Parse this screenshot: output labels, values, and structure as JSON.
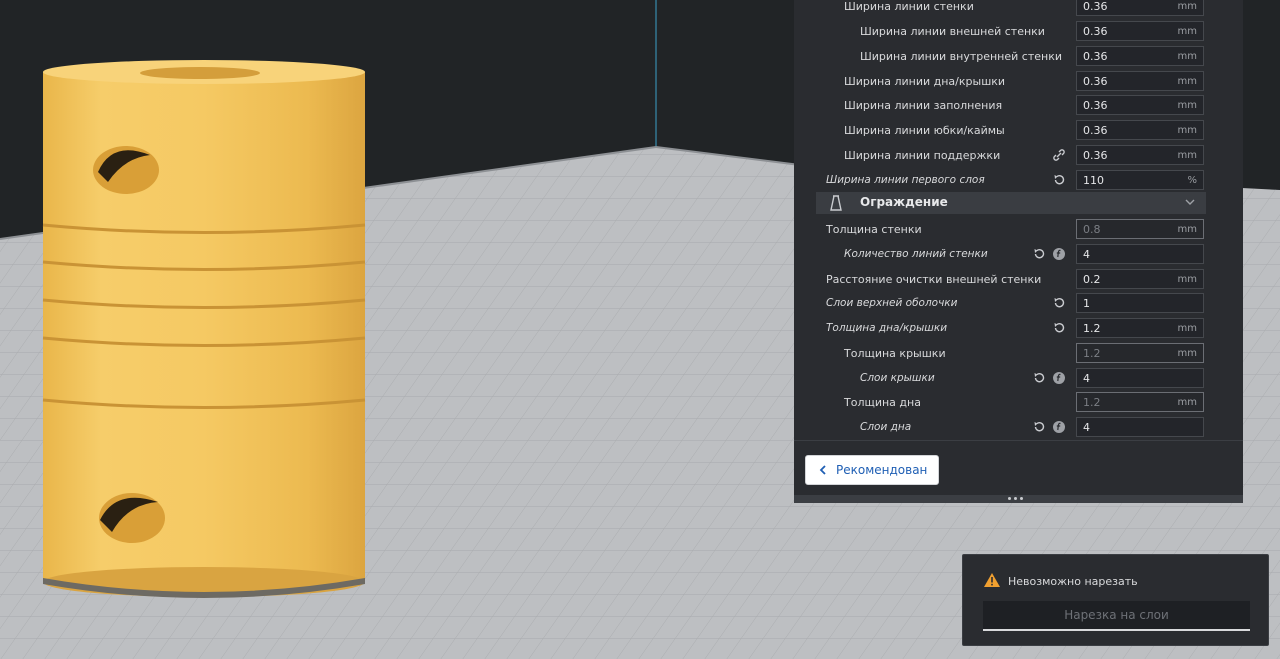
{
  "settings": {
    "line_width_rows": [
      {
        "label": "Ширина линии стенки",
        "value": "0.36",
        "unit": "mm"
      },
      {
        "label": "Ширина линии внешней стенки",
        "value": "0.36",
        "unit": "mm"
      },
      {
        "label": "Ширина линии внутренней стенки",
        "value": "0.36",
        "unit": "mm"
      },
      {
        "label": "Ширина линии дна/крышки",
        "value": "0.36",
        "unit": "mm"
      },
      {
        "label": "Ширина линии заполнения",
        "value": "0.36",
        "unit": "mm"
      },
      {
        "label": "Ширина линии юбки/каймы",
        "value": "0.36",
        "unit": "mm"
      },
      {
        "label": "Ширина линии поддержки",
        "value": "0.36",
        "unit": "mm"
      },
      {
        "label": "Ширина линии первого слоя",
        "value": "110",
        "unit": "%"
      }
    ],
    "section": {
      "title": "Ограждение"
    },
    "shell_rows": [
      {
        "label": "Толщина стенки",
        "value": "0.8",
        "unit": "mm"
      },
      {
        "label": "Количество линий стенки",
        "value": "4",
        "unit": ""
      },
      {
        "label": "Расстояние очистки внешней стенки",
        "value": "0.2",
        "unit": "mm"
      },
      {
        "label": "Слои верхней оболочки",
        "value": "1",
        "unit": ""
      },
      {
        "label": "Толщина дна/крышки",
        "value": "1.2",
        "unit": "mm"
      },
      {
        "label": "Толщина крышки",
        "value": "1.2",
        "unit": "mm"
      },
      {
        "label": "Слои крышки",
        "value": "4",
        "unit": ""
      },
      {
        "label": "Толщина дна",
        "value": "1.2",
        "unit": "mm"
      },
      {
        "label": "Слои дна",
        "value": "4",
        "unit": ""
      }
    ]
  },
  "bottom": {
    "recommended_label": "Рекомендован"
  },
  "toast": {
    "message": "Невозможно нарезать",
    "slice_button_label": "Нарезка на слои"
  },
  "colors": {
    "model": "#f3c55c",
    "panel_bg": "#2a2c30",
    "accent": "#1f5fb4",
    "warning": "#f0a030"
  },
  "icons": [
    "link-icon",
    "reset-icon",
    "function-icon",
    "shell-icon",
    "chevron-down-icon",
    "chevron-left-icon",
    "warning-icon"
  ]
}
